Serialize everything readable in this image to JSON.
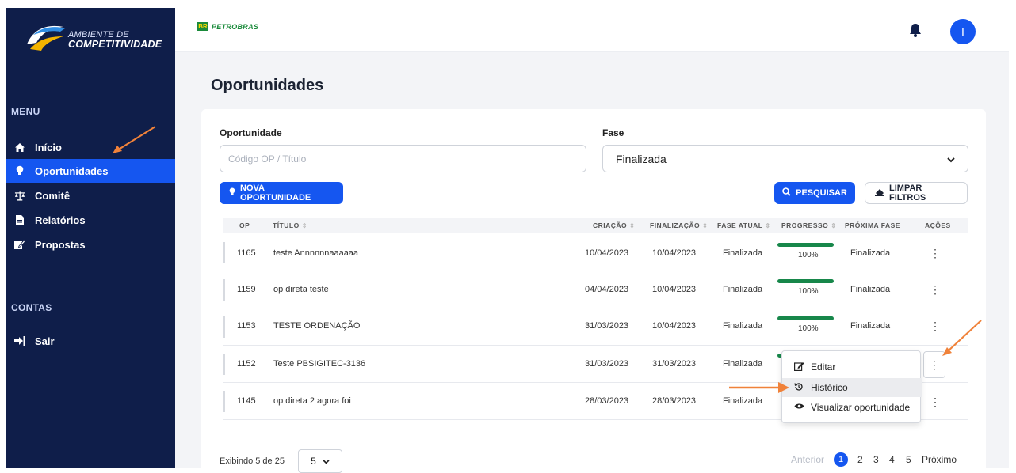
{
  "sidebar": {
    "logo_small": "AMBIENTE DE",
    "logo_big": "COMPETITIVIDADE",
    "menu_title": "MENU",
    "items": [
      {
        "label": "Início",
        "icon": "home-icon",
        "active": false
      },
      {
        "label": "Oportunidades",
        "icon": "lightbulb-icon",
        "active": true
      },
      {
        "label": "Comitê",
        "icon": "scales-icon",
        "active": false
      },
      {
        "label": "Relatórios",
        "icon": "document-icon",
        "active": false
      },
      {
        "label": "Propostas",
        "icon": "edit-icon",
        "active": false
      }
    ],
    "accounts_title": "CONTAS",
    "logout_label": "Sair"
  },
  "topbar": {
    "brand_box": "BR",
    "brand_text": "PETROBRAS",
    "avatar_initial": "I"
  },
  "page": {
    "title": "Oportunidades"
  },
  "filters": {
    "opportunity_label": "Oportunidade",
    "opportunity_placeholder": "Código OP / Título",
    "phase_label": "Fase",
    "phase_value": "Finalizada",
    "new_button": "NOVA OPORTUNIDADE",
    "search_button": "PESQUISAR",
    "clear_button": "LIMPAR FILTROS"
  },
  "table": {
    "headers": {
      "op": "OP",
      "title": "TÍTULO",
      "created": "CRIAÇÃO",
      "finished": "FINALIZAÇÃO",
      "phase": "FASE ATUAL",
      "progress": "PROGRESSO",
      "next": "PRÓXIMA FASE",
      "actions": "AÇÕES"
    },
    "rows": [
      {
        "op": "1165",
        "title": "teste Annnnnnaaaaaa",
        "created": "10/04/2023",
        "finished": "10/04/2023",
        "phase": "Finalizada",
        "progress": "100%",
        "next": "Finalizada"
      },
      {
        "op": "1159",
        "title": "op direta teste",
        "created": "04/04/2023",
        "finished": "10/04/2023",
        "phase": "Finalizada",
        "progress": "100%",
        "next": "Finalizada"
      },
      {
        "op": "1153",
        "title": "TESTE ORDENAÇÃO",
        "created": "31/03/2023",
        "finished": "10/04/2023",
        "phase": "Finalizada",
        "progress": "100%",
        "next": "Finalizada"
      },
      {
        "op": "1152",
        "title": "Teste PBSIGITEC-3136",
        "created": "31/03/2023",
        "finished": "31/03/2023",
        "phase": "Finalizada",
        "progress": "",
        "next": ""
      },
      {
        "op": "1145",
        "title": "op direta 2 agora foi",
        "created": "28/03/2023",
        "finished": "28/03/2023",
        "phase": "Finalizada",
        "progress": "",
        "next": ""
      }
    ]
  },
  "actions_menu": {
    "items": [
      {
        "label": "Editar",
        "icon": "edit-square-icon"
      },
      {
        "label": "Histórico",
        "icon": "history-icon"
      },
      {
        "label": "Visualizar oportunidade",
        "icon": "eye-icon"
      }
    ]
  },
  "footer": {
    "showing": "Exibindo 5 de 25",
    "page_size": "5",
    "prev": "Anterior",
    "pages": [
      "1",
      "2",
      "3",
      "4",
      "5"
    ],
    "next": "Próximo"
  },
  "colors": {
    "sidebar_bg": "#0f1e4a",
    "accent": "#1556f0",
    "progress": "#17874a",
    "annotation_arrow": "#f0823a"
  }
}
